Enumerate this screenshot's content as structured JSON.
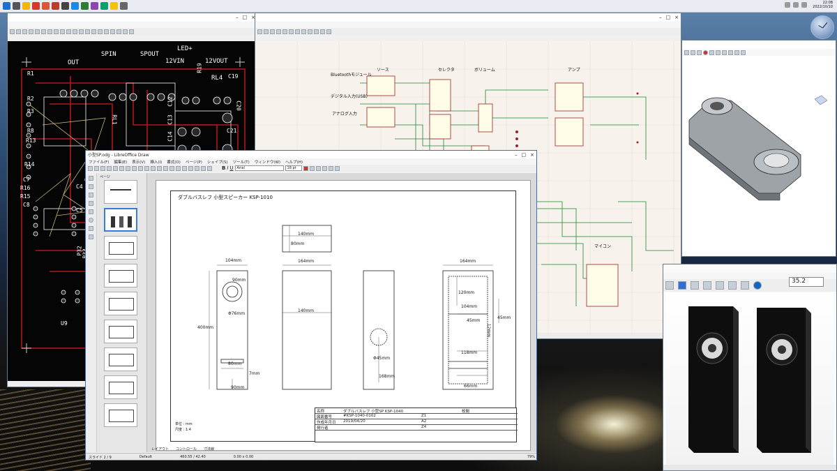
{
  "taskbar": {
    "date": "2022/10/10",
    "time": "22:08"
  },
  "pcb": {
    "labels": {
      "spin": "SPIN",
      "spout": "SPOUT",
      "ledp": "LED+",
      "out": "OUT",
      "v12in": "12VIN",
      "v12out": "12VOUT",
      "r1": "R1",
      "r2": "R2",
      "r3": "R3",
      "r8": "R8",
      "r13": "R13",
      "r14": "R14",
      "c7": "C7",
      "r16": "R16",
      "r15": "R15",
      "c8": "C8",
      "c4": "C4",
      "c5": "C5",
      "rl1": "RL1",
      "rl4": "RL4",
      "c12": "C12",
      "c13": "C13",
      "c14": "C14",
      "c19": "C19",
      "c20": "C20",
      "c21": "C21",
      "r19": "R19",
      "u9": "U9",
      "p32": "P32",
      "p33": "P33"
    }
  },
  "schematic": {
    "labels": {
      "source": "ソース",
      "selector": "セレクタ",
      "volume": "ボリューム",
      "amp": "アンプ",
      "bluetooth": "Bluetoothモジュール",
      "digital": "デジタル入力(USB)",
      "analog": "アナログ入力",
      "mcu": "マイコン"
    }
  },
  "viewer": {
    "zoom": "35.2"
  },
  "draw": {
    "window_title": "小型SP.odg - LibreOffice Draw",
    "menus": [
      "ファイル(F)",
      "編集(E)",
      "表示(V)",
      "挿入(I)",
      "書式(O)",
      "ページ(P)",
      "シェイプ(S)",
      "ツール(T)",
      "ウィンドウ(W)",
      "ヘルプ(H)"
    ],
    "font_name": "Arial",
    "font_size": "18 pt",
    "sidebar_title": "ページ",
    "drawing_title": "ダブルバスレフ 小型スピーカー KSP-1010",
    "dimensions": {
      "w104": "104mm",
      "d90": "90mm",
      "phi76": "Φ76mm",
      "h400": "400mm",
      "w80": "80mm",
      "w7": "7mm",
      "d90b": "90mm",
      "top140": "140mm",
      "top80": "80mm",
      "w164": "164mm",
      "mid140": "140mm",
      "phi45": "Φ45mm",
      "h168": "168mm",
      "w164b": "164mm",
      "h120": "120mm",
      "w104b": "104mm",
      "w45": "45mm",
      "w45b": "45mm",
      "h12": "12mm",
      "w118": "118mm",
      "w66": "66mm"
    },
    "title_block": {
      "name_label": "名称",
      "name_value": "ダブルバスレフ 小型SP KSP-1040",
      "dwg_label": "図面番号",
      "dwg_value": "#KSP-1040-0102",
      "date_label": "作成年月日",
      "date_value": "2019/04/20",
      "author_label": "発行者",
      "rev1": "Z1",
      "rev2": "A2",
      "rev3": "Z4",
      "approve": "校閲",
      "unit_label": "単位 : mm",
      "scale_label": "尺度 : 1:4"
    },
    "tabs": [
      "レイアウト",
      "コントロール",
      "寸法線"
    ],
    "status": {
      "slide": "スライド 2 / 9",
      "style": "Default",
      "coords": "460.55 / 42.40",
      "size": "0.00 x 0.00",
      "zoom": "79%"
    }
  }
}
